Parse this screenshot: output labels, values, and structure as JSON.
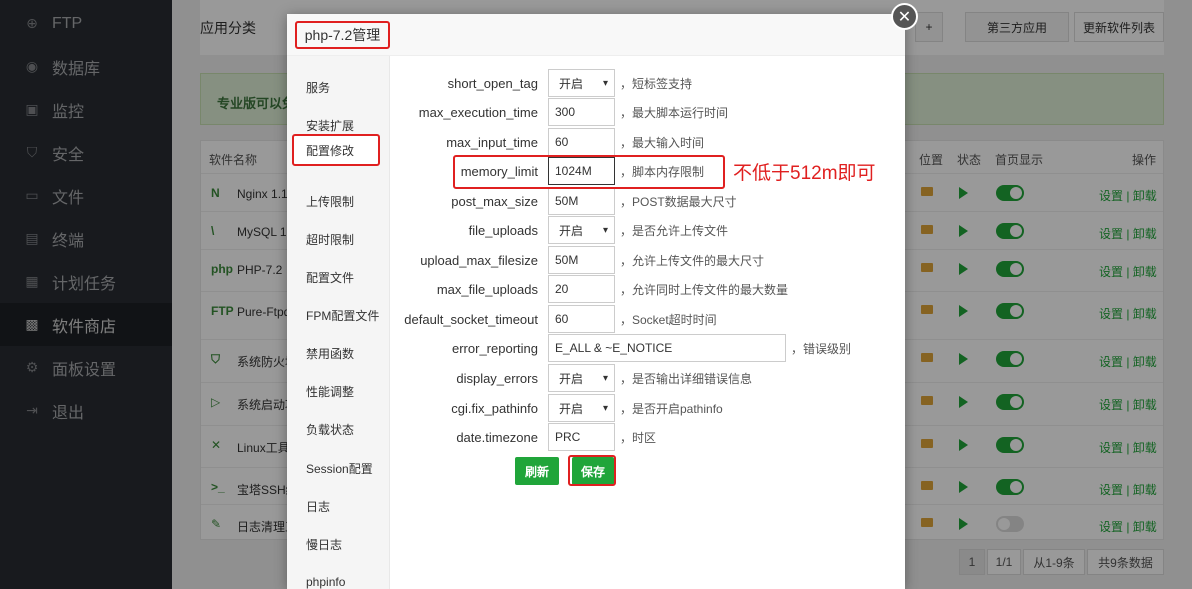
{
  "sidebar": {
    "items": [
      {
        "label": "FTP",
        "icon": "globe-icon",
        "glyph": "⊕"
      },
      {
        "label": "数据库",
        "icon": "database-icon",
        "glyph": "◉"
      },
      {
        "label": "监控",
        "icon": "monitor-icon",
        "glyph": "▣"
      },
      {
        "label": "安全",
        "icon": "shield-icon",
        "glyph": "⛉"
      },
      {
        "label": "文件",
        "icon": "folder-icon",
        "glyph": "▭"
      },
      {
        "label": "终端",
        "icon": "terminal-icon",
        "glyph": "▤"
      },
      {
        "label": "计划任务",
        "icon": "calendar-icon",
        "glyph": "▦"
      },
      {
        "label": "软件商店",
        "icon": "grid-icon",
        "glyph": "▩"
      },
      {
        "label": "面板设置",
        "icon": "gear-icon",
        "glyph": "⚙"
      },
      {
        "label": "退出",
        "icon": "logout-icon",
        "glyph": "⇥"
      }
    ]
  },
  "main": {
    "category_label": "应用分类",
    "third_party_btn": "第三方应用",
    "update_list_btn": "更新软件列表",
    "plus_btn": "+",
    "banner": "专业版可以免",
    "table_headers": {
      "name": "软件名称",
      "location": "位置",
      "status": "状态",
      "homepage": "首页显示",
      "ops": "操作"
    },
    "rows": [
      {
        "icon": "N",
        "name": "Nginx 1.1",
        "home": true
      },
      {
        "icon": "\\",
        "name": "MySQL 1",
        "home": true
      },
      {
        "icon": "php",
        "name": "PHP-7.2",
        "home": true
      },
      {
        "icon": "FTP",
        "name": "Pure-Ftpd",
        "home": true
      },
      {
        "icon": "⛉",
        "name": "系统防火墙",
        "home": true
      },
      {
        "icon": "▷",
        "name": "系统启动项",
        "home": true
      },
      {
        "icon": "✕",
        "name": "Linux工具",
        "home": true
      },
      {
        "icon": ">_",
        "name": "宝塔SSH终",
        "home": true
      },
      {
        "icon": "✎",
        "name": "日志清理工",
        "home": false
      }
    ],
    "ops_label": "设置 | 卸载",
    "pager": {
      "current": "1",
      "pages": "1/1",
      "range": "从1-9条",
      "total": "共9条数据"
    }
  },
  "modal": {
    "title": "php-7.2管理",
    "close_glyph": "✕",
    "nav": [
      "服务",
      "安装扩展",
      "配置修改",
      "上传限制",
      "超时限制",
      "配置文件",
      "FPM配置文件",
      "禁用函数",
      "性能调整",
      "负载状态",
      "Session配置",
      "日志",
      "慢日志",
      "phpinfo"
    ],
    "active_nav": "配置修改",
    "fields": [
      {
        "name": "short_open_tag",
        "type": "select",
        "value": "开启",
        "desc": "，短标签支持"
      },
      {
        "name": "max_execution_time",
        "type": "input",
        "value": "300",
        "desc": "，最大脚本运行时间"
      },
      {
        "name": "max_input_time",
        "type": "input",
        "value": "60",
        "desc": "，最大输入时间"
      },
      {
        "name": "memory_limit",
        "type": "input",
        "value": "1024M",
        "desc": "，脚本内存限制"
      },
      {
        "name": "post_max_size",
        "type": "input",
        "value": "50M",
        "desc": "，POST数据最大尺寸"
      },
      {
        "name": "file_uploads",
        "type": "select",
        "value": "开启",
        "desc": "，是否允许上传文件"
      },
      {
        "name": "upload_max_filesize",
        "type": "input",
        "value": "50M",
        "desc": "，允许上传文件的最大尺寸"
      },
      {
        "name": "max_file_uploads",
        "type": "input",
        "value": "20",
        "desc": "，允许同时上传文件的最大数量"
      },
      {
        "name": "default_socket_timeout",
        "type": "input",
        "value": "60",
        "desc": "，Socket超时时间"
      },
      {
        "name": "error_reporting",
        "type": "input-wide",
        "value": "E_ALL & ~E_NOTICE",
        "desc": "，错误级别"
      },
      {
        "name": "display_errors",
        "type": "select",
        "value": "开启",
        "desc": "，是否输出详细错误信息"
      },
      {
        "name": "cgi.fix_pathinfo",
        "type": "select",
        "value": "开启",
        "desc": "，是否开启pathinfo"
      },
      {
        "name": "date.timezone",
        "type": "input",
        "value": "PRC",
        "desc": "，时区"
      }
    ],
    "refresh_btn": "刷新",
    "save_btn": "保存",
    "annotation": "不低于512m即可"
  },
  "colors": {
    "accent": "#20a53a",
    "highlight": "#e02020",
    "sidebar_bg": "#2c3138"
  }
}
